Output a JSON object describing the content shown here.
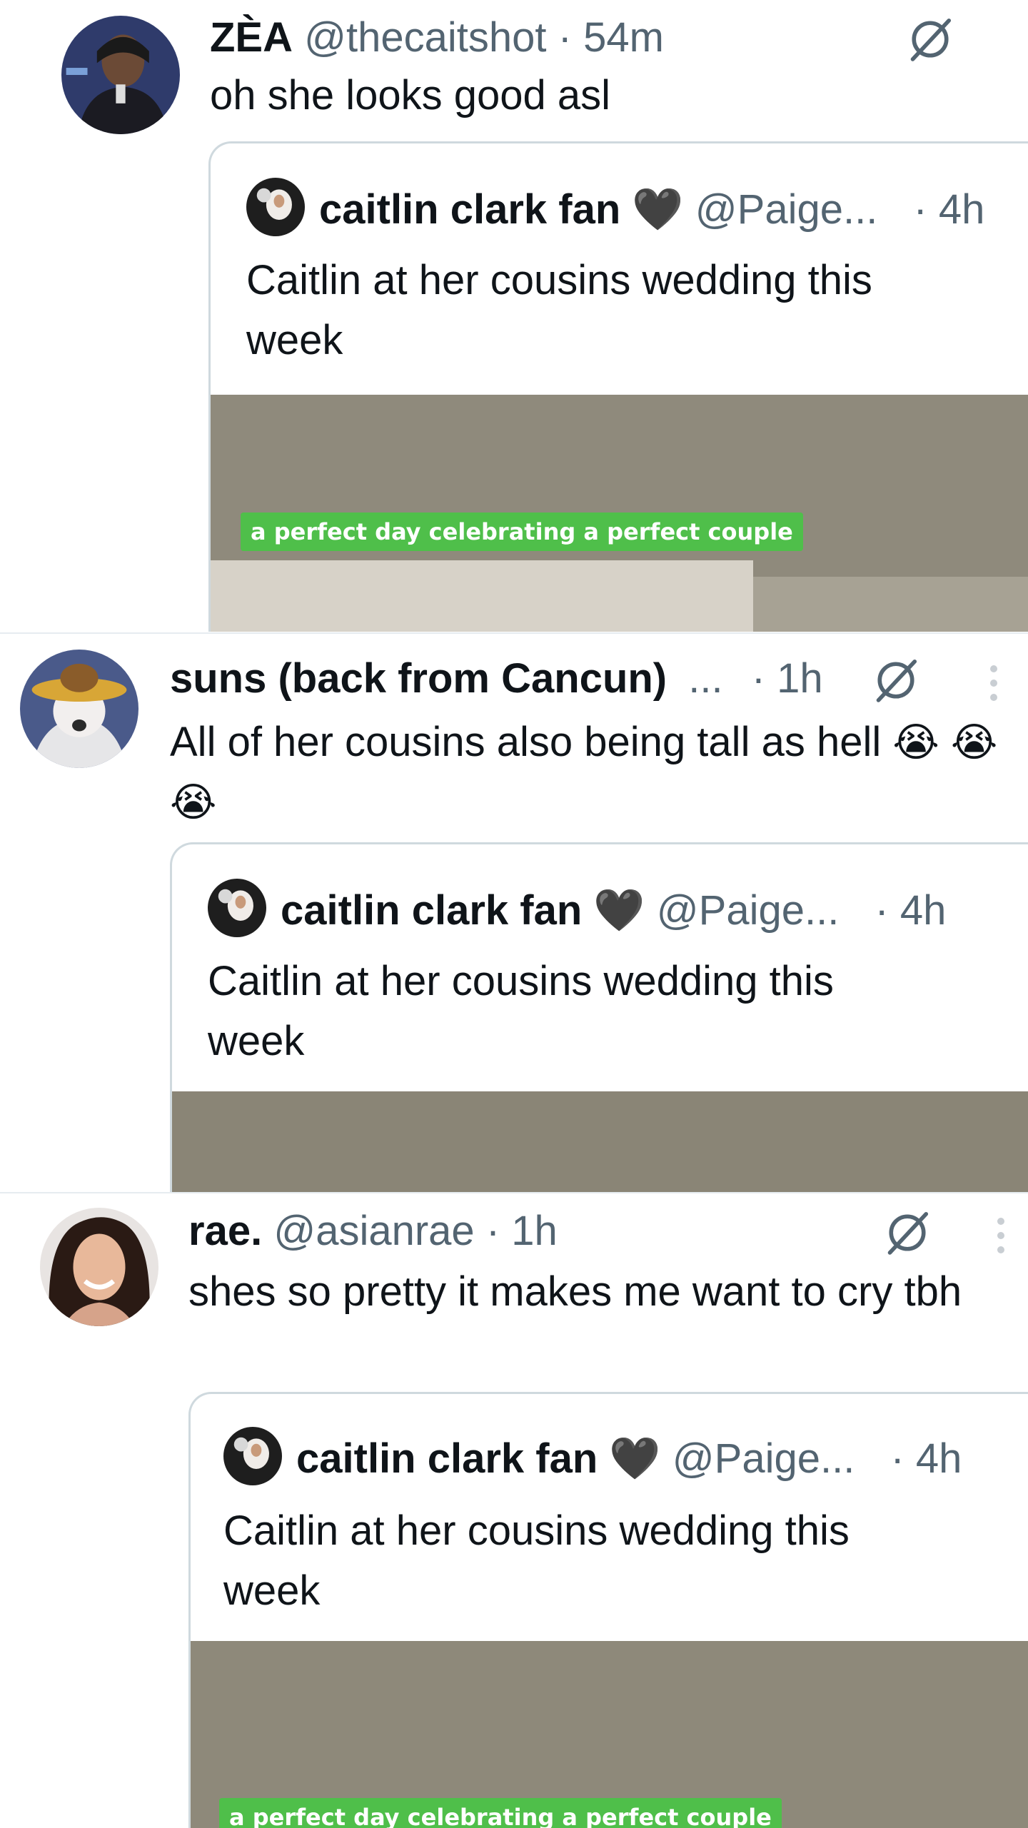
{
  "posts": [
    {
      "name": "ZÈA",
      "handle": "@thecaitshot",
      "dot": "·",
      "time": "54m",
      "text": "oh she looks good asl",
      "quote": {
        "name": "caitlin clark fan",
        "heart": "🖤",
        "handle": "@Paige...",
        "time": "· 4h",
        "text": "Caitlin at her cousins wedding this week",
        "caption": "a perfect day celebrating a perfect couple"
      }
    },
    {
      "name": "suns (back from Cancun)",
      "ellipsis": "...",
      "dot": "·",
      "time": "1h",
      "text": "All of her cousins also being tall as hell",
      "emoji": "😭",
      "quote": {
        "name": "caitlin clark fan",
        "heart": "🖤",
        "handle": "@Paige...",
        "time": "· 4h",
        "text": "Caitlin at her cousins wedding this week"
      }
    },
    {
      "name": "rae.",
      "handle": "@asianrae",
      "dot": "·",
      "time": "1h",
      "text": "shes so pretty it makes me want to cry tbh",
      "quote": {
        "name": "caitlin clark fan",
        "heart": "🖤",
        "handle": "@Paige...",
        "time": "· 4h",
        "text": "Caitlin at her cousins wedding this week",
        "caption": "a perfect day celebrating a perfect couple"
      }
    }
  ],
  "icons": {
    "grok": "grok-icon",
    "more": "more-vertical-icon"
  },
  "colors": {
    "text": "#0f1419",
    "muted": "#536471",
    "border": "#cfd9de",
    "caption_bg": "#4fbf4a",
    "media_bg": "#8c887a"
  }
}
